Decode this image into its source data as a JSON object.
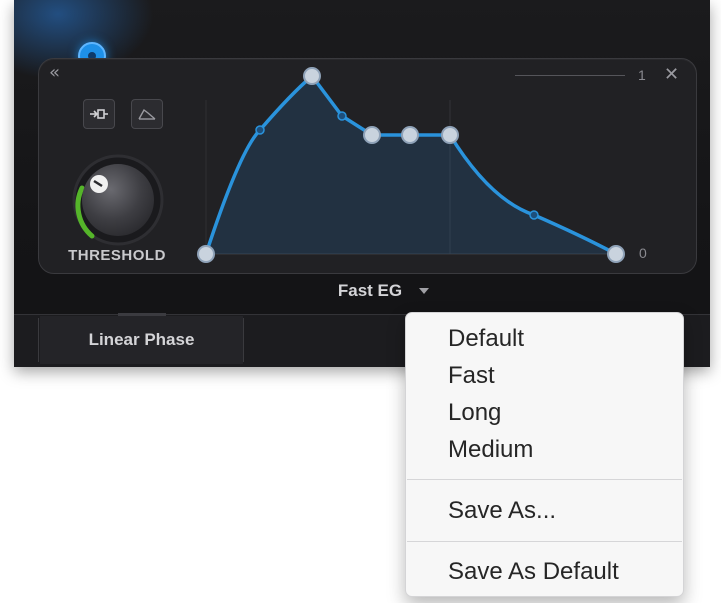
{
  "panel": {
    "collapse_icon": "double-chevron-left-icon",
    "close_icon": "close-icon",
    "scale_max_label": "1",
    "scale_min_label": "0"
  },
  "controls": {
    "sidechain_button_icon": "sidechain-icon",
    "envelope_button_icon": "envelope-shape-icon",
    "knob_label": "THRESHOLD"
  },
  "preset": {
    "name": "Fast EG"
  },
  "tabs": {
    "linear_phase": "Linear Phase"
  },
  "menu": {
    "items": [
      "Default",
      "Fast",
      "Long",
      "Medium"
    ],
    "save_as": "Save As...",
    "save_as_default": "Save As Default"
  },
  "colors": {
    "accent": "#1e90e8",
    "curve": "#2a93dc",
    "panel": "#212124",
    "menu_bg": "#f7f7f7"
  }
}
